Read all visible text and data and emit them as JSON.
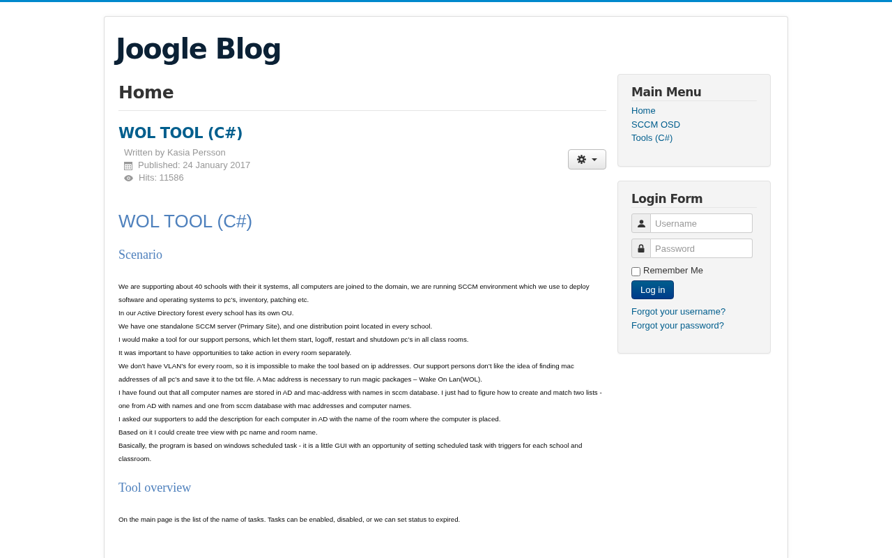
{
  "site_title": "Joogle Blog",
  "page_heading": "Home",
  "article": {
    "title": "WOL TOOL (C#)",
    "author": "Written by Kasia Persson",
    "published": "Published: 24 January 2017",
    "hits": "Hits: 11586",
    "content": [
      {
        "kind": "title",
        "text": "WOL TOOL (C#)"
      },
      {
        "kind": "heading",
        "text": "Scenario"
      },
      {
        "kind": "paragraph",
        "text": "We are supporting about 40 schools with their it systems, all computers are joined to the domain, we are running SCCM environment which we use to deploy software and operating systems to pc’s, inventory, patching etc."
      },
      {
        "kind": "paragraph",
        "text": "In our Active Directory forest every school has its own OU."
      },
      {
        "kind": "paragraph",
        "text": "We have one standalone SCCM server (Primary Site), and one distribution point located in every school."
      },
      {
        "kind": "paragraph",
        "text": "I would make a tool for our support persons, which let them start, logoff, restart and shutdown pc’s in all class rooms."
      },
      {
        "kind": "paragraph",
        "text": "It was important to have opportunities to take action in every room separately."
      },
      {
        "kind": "paragraph",
        "text": "We don’t have VLAN’s for every room, so it is impossible to make the tool based on ip addresses. Our support persons don’t like the idea of finding mac addresses of all pc’s and save it to the txt file. A Mac address is necessary to run magic packages – Wake On Lan(WOL)."
      },
      {
        "kind": "paragraph",
        "text": "I have found out that all computer names are stored in AD and mac-address with names in sccm database. I just had to figure how to create and match two lists - one from AD with names and one from sccm database with mac addresses and computer names."
      },
      {
        "kind": "paragraph",
        "text": "I asked our supporters to add the description for each computer in AD with the name of the room where the computer is placed."
      },
      {
        "kind": "paragraph",
        "text": "Based on it I could create tree view with pc name and room name."
      },
      {
        "kind": "paragraph",
        "text": "Basically, the program is based on windows scheduled task - it is a little GUI with an opportunity of setting scheduled task with triggers for each school and classroom."
      },
      {
        "kind": "heading",
        "text": "Tool overview"
      },
      {
        "kind": "paragraph",
        "text": "On the main page is the list of the name of tasks. Tasks can be enabled, disabled, or we can set status to expired."
      }
    ]
  },
  "main_menu": {
    "title": "Main Menu",
    "items": [
      "Home",
      "SCCM OSD",
      "Tools (C#)"
    ]
  },
  "login_form": {
    "title": "Login Form",
    "username": {
      "placeholder": "Username"
    },
    "password": {
      "placeholder": "Password"
    },
    "remember": {
      "label": "Remember Me",
      "checked": false
    },
    "login_button": "Log in",
    "links": [
      "Forgot your username?",
      "Forgot your password?"
    ]
  }
}
